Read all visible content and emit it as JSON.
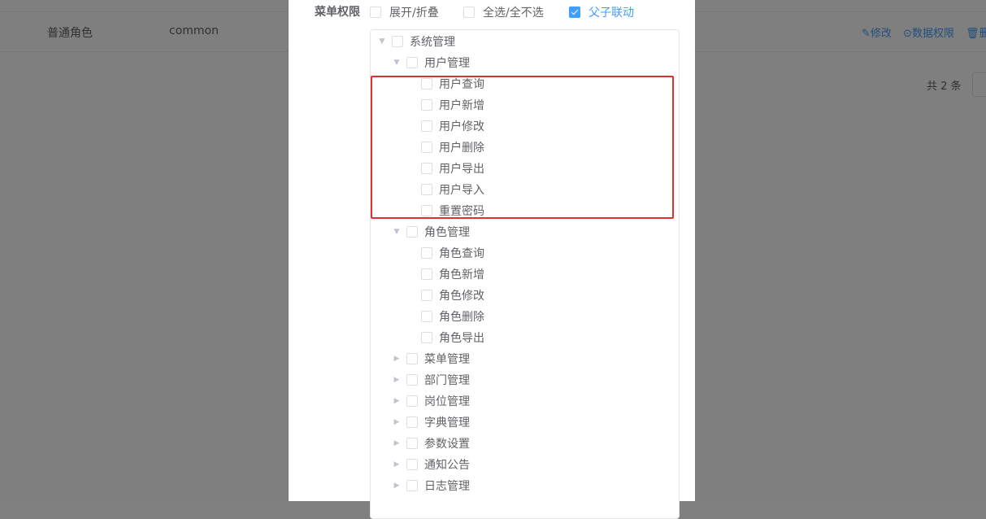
{
  "background": {
    "row": {
      "role_name": "普通角色",
      "role_key": "common"
    },
    "ops": {
      "edit": "✎修改",
      "data_scope": "⊙数据权限",
      "delete": "🗑删除"
    },
    "total": "共 2 条"
  },
  "dialog": {
    "menu_perm_label": "菜单权限",
    "options": [
      {
        "label": "展开/折叠",
        "checked": false
      },
      {
        "label": "全选/全不选",
        "checked": false
      },
      {
        "label": "父子联动",
        "checked": true
      }
    ],
    "tree": [
      {
        "label": "系统管理",
        "level": 0,
        "arrow": "expanded"
      },
      {
        "label": "用户管理",
        "level": 1,
        "arrow": "expanded"
      },
      {
        "label": "用户查询",
        "level": 2,
        "arrow": "none"
      },
      {
        "label": "用户新增",
        "level": 2,
        "arrow": "none"
      },
      {
        "label": "用户修改",
        "level": 2,
        "arrow": "none"
      },
      {
        "label": "用户删除",
        "level": 2,
        "arrow": "none"
      },
      {
        "label": "用户导出",
        "level": 2,
        "arrow": "none"
      },
      {
        "label": "用户导入",
        "level": 2,
        "arrow": "none"
      },
      {
        "label": "重置密码",
        "level": 2,
        "arrow": "none"
      },
      {
        "label": "角色管理",
        "level": 1,
        "arrow": "expanded"
      },
      {
        "label": "角色查询",
        "level": 2,
        "arrow": "none"
      },
      {
        "label": "角色新增",
        "level": 2,
        "arrow": "none"
      },
      {
        "label": "角色修改",
        "level": 2,
        "arrow": "none"
      },
      {
        "label": "角色删除",
        "level": 2,
        "arrow": "none"
      },
      {
        "label": "角色导出",
        "level": 2,
        "arrow": "none"
      },
      {
        "label": "菜单管理",
        "level": 1,
        "arrow": "collapsed"
      },
      {
        "label": "部门管理",
        "level": 1,
        "arrow": "collapsed"
      },
      {
        "label": "岗位管理",
        "level": 1,
        "arrow": "collapsed"
      },
      {
        "label": "字典管理",
        "level": 1,
        "arrow": "collapsed"
      },
      {
        "label": "参数设置",
        "level": 1,
        "arrow": "collapsed"
      },
      {
        "label": "通知公告",
        "level": 1,
        "arrow": "collapsed"
      },
      {
        "label": "日志管理",
        "level": 1,
        "arrow": "collapsed"
      }
    ]
  },
  "colors": {
    "accent": "#409eff",
    "highlight": "#e03131"
  }
}
